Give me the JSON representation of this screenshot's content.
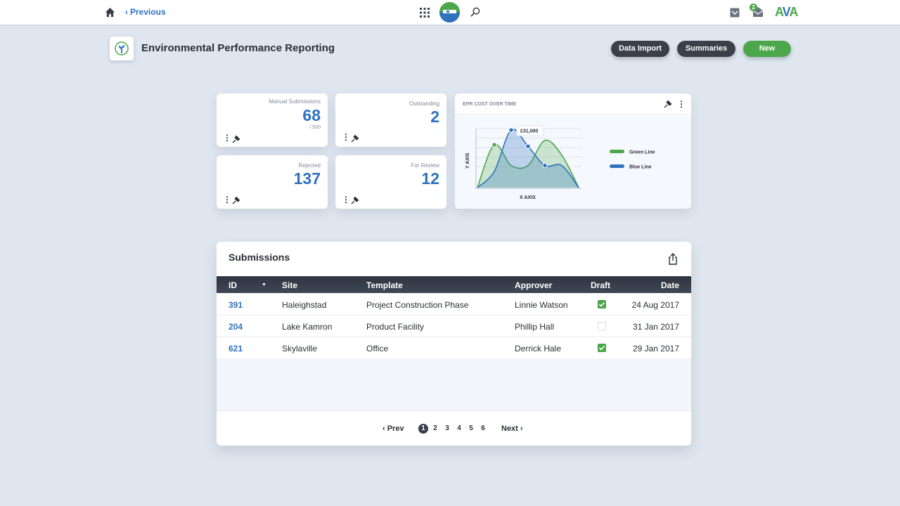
{
  "nav": {
    "previous_label": "Previous",
    "notifications_count": "2",
    "brand": {
      "a1": "A",
      "v": "V",
      "a2": "A"
    }
  },
  "header": {
    "title": "Environmental Performance Reporting",
    "buttons": {
      "data_import": "Data Import",
      "summaries": "Summaries",
      "new": "New"
    }
  },
  "stats": [
    {
      "label": "Manual Submissions",
      "value": "68",
      "sub": "/ 500"
    },
    {
      "label": "Outstanding",
      "value": "2"
    },
    {
      "label": "Rejected",
      "value": "137"
    },
    {
      "label": "For Review",
      "value": "12"
    }
  ],
  "chart_data": {
    "type": "area",
    "title": "EPR COST OVER TIME",
    "xlabel": "X AXIS",
    "ylabel": "Y AXIS",
    "grid": true,
    "legend_position": "right",
    "annotation": "£31,000",
    "x": [
      0,
      1,
      2,
      3,
      4,
      5,
      6
    ],
    "series": [
      {
        "name": "Green Line",
        "color": "#4ca64a",
        "values": [
          0,
          1.45,
          0.75,
          0.75,
          1.6,
          1.1,
          0
        ]
      },
      {
        "name": "Blue Line",
        "color": "#2f72bd",
        "values": [
          0,
          0.55,
          1.95,
          1.4,
          0.75,
          0.75,
          0
        ]
      }
    ]
  },
  "submissions": {
    "title": "Submissions",
    "columns": [
      "ID",
      "Site",
      "Template",
      "Approver",
      "Draft",
      "Date"
    ],
    "rows": [
      {
        "id": "391",
        "site": "Haleighstad",
        "template": "Project Construction Phase",
        "approver": "Linnie Watson",
        "draft": true,
        "date": "24 Aug 2017"
      },
      {
        "id": "204",
        "site": "Lake Kamron",
        "template": "Product Facility",
        "approver": "Phillip Hall",
        "draft": false,
        "date": "31 Jan 2017"
      },
      {
        "id": "621",
        "site": "Skylaville",
        "template": "Office",
        "approver": "Derrick Hale",
        "draft": true,
        "date": "29 Jan 2017"
      }
    ],
    "pagination": {
      "prev": "‹ Prev",
      "next": "Next ›",
      "pages": [
        "1",
        "2",
        "3",
        "4",
        "5",
        "6"
      ],
      "current": "1"
    }
  },
  "colors": {
    "accent": "#2f72bd",
    "success": "#4ca64a",
    "dark": "#3a3f49"
  },
  "icons": [
    "home-icon",
    "apps-grid-icon",
    "search-icon",
    "tray-icon",
    "mail-icon",
    "pin-icon",
    "kebab-menu-icon",
    "export-icon",
    "sort-caret-icon"
  ]
}
